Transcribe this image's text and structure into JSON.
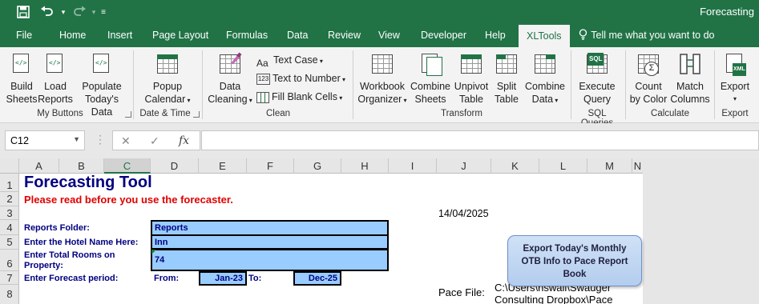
{
  "titlebar": {
    "title": "Forecasting",
    "bg": "#217346"
  },
  "tabs": [
    {
      "label": "File"
    },
    {
      "label": "Home"
    },
    {
      "label": "Insert"
    },
    {
      "label": "Page Layout"
    },
    {
      "label": "Formulas"
    },
    {
      "label": "Data"
    },
    {
      "label": "Review"
    },
    {
      "label": "View"
    },
    {
      "label": "Developer"
    },
    {
      "label": "Help"
    },
    {
      "label": "XLTools",
      "active": true
    },
    {
      "label": "Tell me what you want to do",
      "icon": "lightbulb-icon"
    }
  ],
  "ribbon": {
    "build_sheets": "Build\nSheets",
    "load_reports": "Load\nReports",
    "populate_data": "Populate\nToday's Data",
    "popup_calendar": "Popup\nCalendar",
    "data_cleaning": "Data\nCleaning",
    "text_case": "Text Case",
    "text_to_number": "Text to Number",
    "fill_blank_cells": "Fill Blank Cells",
    "workbook_organizer": "Workbook\nOrganizer",
    "combine_sheets": "Combine\nSheets",
    "unpivot_table": "Unpivot\nTable",
    "split_table": "Split\nTable",
    "combine_data": "Combine\nData",
    "execute_query": "Execute\nQuery",
    "count_by_color": "Count\nby Color",
    "match_columns": "Match\nColumns",
    "export": "Export",
    "groups": {
      "my_buttons": "My Buttons",
      "date_time": "Date & Time",
      "clean": "Clean",
      "transform": "Transform",
      "sql_queries": "SQL Queries",
      "calculate": "Calculate",
      "export": "Export"
    }
  },
  "formula_bar": {
    "name_box": "C12",
    "cancel": "✕",
    "enter": "✓",
    "fx": "fx",
    "value": ""
  },
  "sheet": {
    "columns": [
      "A",
      "B",
      "C",
      "D",
      "E",
      "F",
      "G",
      "H",
      "I",
      "J",
      "K",
      "L",
      "M",
      "N"
    ],
    "selected_column": "C",
    "rows": [
      "1",
      "2",
      "3",
      "4",
      "5",
      "6",
      "7",
      "8"
    ],
    "title": "Forecasting Tool",
    "warning": "Please read before you use the forecaster.",
    "date": "14/04/2025",
    "reports_folder_label": "Reports Folder:",
    "reports_folder_value": "Reports",
    "hotel_name_label": "Enter the Hotel Name Here:",
    "hotel_name_value": "Inn",
    "total_rooms_label": "Enter Total Rooms on\nProperty:",
    "total_rooms_value": "74",
    "forecast_period_label": "Enter Forecast period:",
    "from_label": "From:",
    "from_value": "Jan-23",
    "to_label": "To:",
    "to_value": "Dec-25",
    "pace_file_label": "Pace File:",
    "pace_file_value": "C:\\Users\\hswall\\Swauger\nConsulting Dropbox\\Pace",
    "export_button": "Export Today's Monthly\nOTB Info to Pace Report\nBook"
  }
}
